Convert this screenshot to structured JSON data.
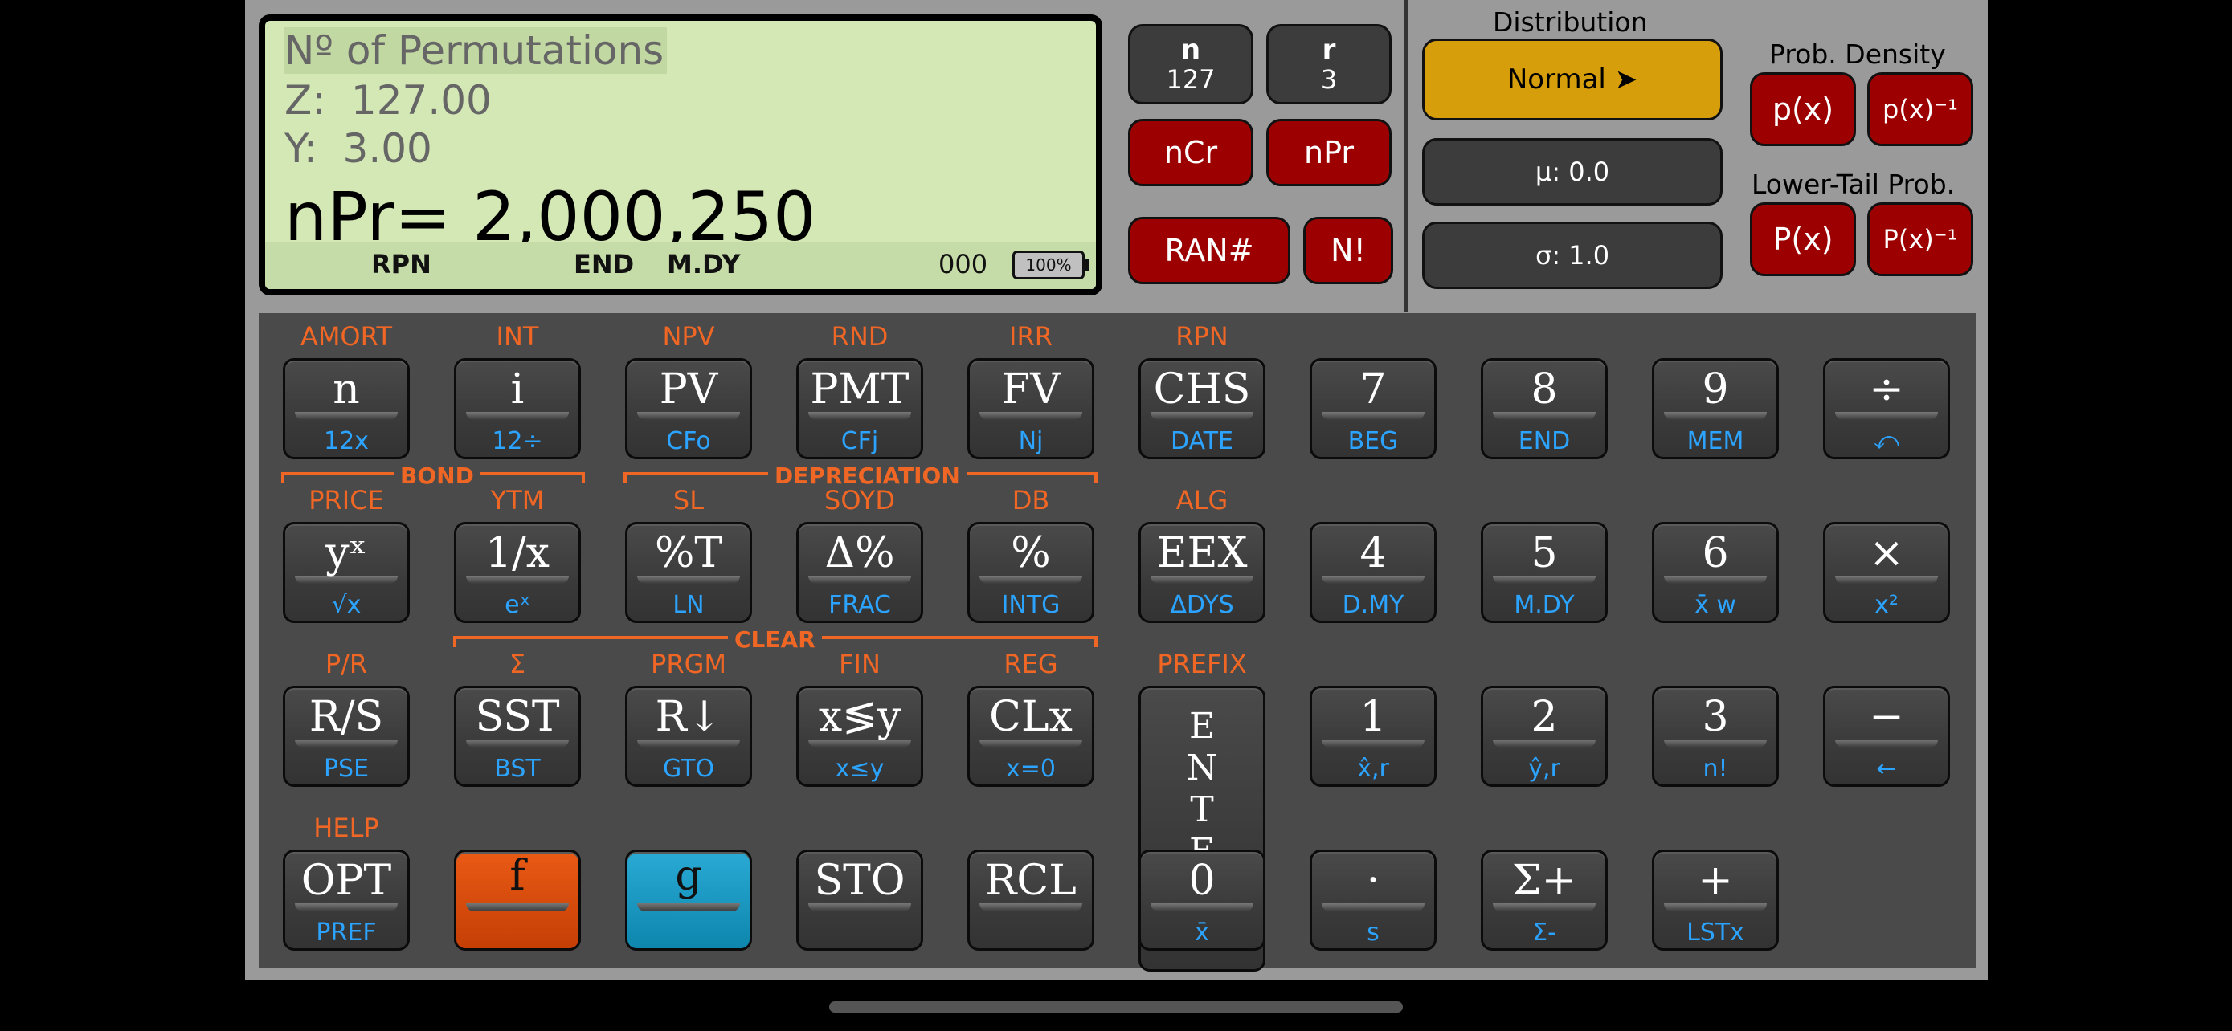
{
  "display": {
    "line1": "Nº of Permutations",
    "line2": "Z:  127.00",
    "line3": "Y:  3.00",
    "main": "nPr= 2,000,250",
    "status": {
      "mode": "RPN",
      "timing": "END",
      "date_format": "M.DY",
      "reg": "000",
      "battery": "100%"
    }
  },
  "side": {
    "n": {
      "label": "n",
      "value": "127"
    },
    "r": {
      "label": "r",
      "value": "3"
    },
    "ncr": "nCr",
    "npr": "nPr",
    "ran": "RAN#",
    "fact": "N!",
    "distribution_label": "Distribution",
    "distribution": "Normal ➤",
    "mu": "μ: 0.0",
    "sigma": "σ: 1.0",
    "prob_density_label": "Prob. Density",
    "px": "p(x)",
    "px_inv": "p(x)⁻¹",
    "lower_tail_label": "Lower-Tail Prob.",
    "cpx": "P(x)",
    "cpx_inv": "P(x)⁻¹"
  },
  "keys": [
    {
      "top": "AMORT",
      "main": "n",
      "sub": "12x"
    },
    {
      "top": "INT",
      "main": "i",
      "sub": "12÷"
    },
    {
      "top": "NPV",
      "main": "PV",
      "sub": "CFo"
    },
    {
      "top": "RND",
      "main": "PMT",
      "sub": "CFj"
    },
    {
      "top": "IRR",
      "main": "FV",
      "sub": "Nj"
    },
    {
      "top": "RPN",
      "main": "CHS",
      "sub": "DATE"
    },
    {
      "top": "",
      "main": "7",
      "sub": "BEG"
    },
    {
      "top": "",
      "main": "8",
      "sub": "END"
    },
    {
      "top": "",
      "main": "9",
      "sub": "MEM"
    },
    {
      "top": "",
      "main": "÷",
      "sub": "⤺"
    },
    {
      "top": "PRICE",
      "main": "yˣ",
      "sub": "√x"
    },
    {
      "top": "YTM",
      "main": "1/x",
      "sub": "eˣ"
    },
    {
      "top": "SL",
      "main": "%T",
      "sub": "LN"
    },
    {
      "top": "SOYD",
      "main": "Δ%",
      "sub": "FRAC"
    },
    {
      "top": "DB",
      "main": "%",
      "sub": "INTG"
    },
    {
      "top": "ALG",
      "main": "EEX",
      "sub": "ΔDYS"
    },
    {
      "top": "",
      "main": "4",
      "sub": "D.MY"
    },
    {
      "top": "",
      "main": "5",
      "sub": "M.DY"
    },
    {
      "top": "",
      "main": "6",
      "sub": "x̄ w"
    },
    {
      "top": "",
      "main": "×",
      "sub": "x²"
    },
    {
      "top": "P/R",
      "main": "R/S",
      "sub": "PSE"
    },
    {
      "top": "Σ",
      "main": "SST",
      "sub": "BST"
    },
    {
      "top": "PRGM",
      "main": "R↓",
      "sub": "GTO"
    },
    {
      "top": "FIN",
      "main": "x≶y",
      "sub": "x≤y"
    },
    {
      "top": "REG",
      "main": "CLx",
      "sub": "x=0"
    },
    {
      "top": "PREFIX",
      "main": "E\nN\nT\nE\nR",
      "sub": ""
    },
    {
      "top": "",
      "main": "1",
      "sub": "x̂,r"
    },
    {
      "top": "",
      "main": "2",
      "sub": "ŷ,r"
    },
    {
      "top": "",
      "main": "3",
      "sub": "n!"
    },
    {
      "top": "",
      "main": "−",
      "sub": "←"
    },
    {
      "top": "HELP",
      "main": "OPT",
      "sub": "PREF"
    },
    {
      "top": "",
      "main": "f",
      "sub": ""
    },
    {
      "top": "",
      "main": "g",
      "sub": ""
    },
    {
      "top": "",
      "main": "STO",
      "sub": ""
    },
    {
      "top": "",
      "main": "RCL",
      "sub": ""
    },
    {
      "top": "",
      "main": "0",
      "sub": "x̄"
    },
    {
      "top": "",
      "main": "·",
      "sub": "s"
    },
    {
      "top": "",
      "main": "Σ+",
      "sub": "Σ-"
    },
    {
      "top": "",
      "main": "+",
      "sub": "LSTx"
    }
  ],
  "brackets": {
    "bond": "BOND",
    "depreciation": "DEPRECIATION",
    "clear": "CLEAR"
  }
}
